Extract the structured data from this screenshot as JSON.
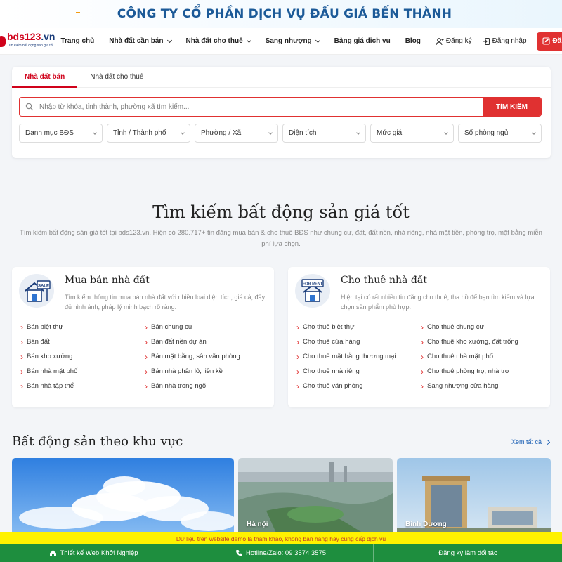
{
  "banner": {
    "title": "CÔNG TY CỔ PHẦN DỊCH VỤ ĐẤU GIÁ BẾN THÀNH"
  },
  "logo": {
    "main": "bds123",
    "tld": ".vn",
    "tagline": "Tìm kiếm bất động sản giá tốt"
  },
  "nav": {
    "items": [
      {
        "label": "Trang chủ",
        "dropdown": false
      },
      {
        "label": "Nhà đất cần bán",
        "dropdown": true
      },
      {
        "label": "Nhà đất cho thuê",
        "dropdown": true
      },
      {
        "label": "Sang nhượng",
        "dropdown": true
      },
      {
        "label": "Bảng giá dịch vụ",
        "dropdown": false
      },
      {
        "label": "Blog",
        "dropdown": false
      }
    ],
    "register": "Đăng ký",
    "login": "Đăng nhập",
    "post": "Đăng tin"
  },
  "search": {
    "tabs": [
      "Nhà đất bán",
      "Nhà đất cho thuê"
    ],
    "active_tab": 0,
    "placeholder": "Nhập từ khóa, tỉnh thành, phường xã tìm kiếm...",
    "button": "TÌM KIẾM",
    "filters": [
      "Danh mục BĐS",
      "Tỉnh / Thành phố",
      "Phường / Xã",
      "Diện tích",
      "Mức giá",
      "Số phòng ngủ"
    ]
  },
  "hero": {
    "title": "Tìm kiếm bất động sản giá tốt",
    "desc": "Tìm kiếm bất động sản giá tốt tại bds123.vn. Hiện có 280.717+ tin đăng mua bán & cho thuê BĐS như chung cư, đất, đất nền, nhà riêng, nhà mặt tiền, phòng trọ, mặt bằng miễn phí lựa chọn."
  },
  "cards": [
    {
      "title": "Mua bán nhà đất",
      "desc": "Tìm kiếm thông tin mua bán nhà đất với nhiều loại diện tích, giá cả, đầy đủ hình ảnh, pháp lý minh bạch rõ ràng.",
      "icon_text": "SALE",
      "links": [
        "Bán biệt thự",
        "Bán chung cư",
        "Bán đất",
        "Bán đất nền dự án",
        "Bán kho xưởng",
        "Bán mặt bằng, sân văn phòng",
        "Bán nhà mặt phố",
        "Bán nhà phân lô, liền kề",
        "Bán nhà tập thể",
        "Bán nhà trong ngõ"
      ]
    },
    {
      "title": "Cho thuê nhà đất",
      "desc": "Hiện tại có rất nhiều tin đăng cho thuê, tha hồ để bạn tìm kiếm và lựa chọn sản phẩm phù hợp.",
      "icon_text": "FOR RENT",
      "links": [
        "Cho thuê biệt thự",
        "Cho thuê chung cư",
        "Cho thuê cửa hàng",
        "Cho thuê kho xưởng, đất trống",
        "Cho thuê mặt bằng thương mại",
        "Cho thuê nhà mặt phố",
        "Cho thuê nhà riêng",
        "Cho thuê phòng trọ, nhà trọ",
        "Cho thuê văn phòng",
        "Sang nhượng cửa hàng"
      ]
    }
  ],
  "areas": {
    "title": "Bất động sản theo khu vực",
    "see_all": "Xem tất cả",
    "items": [
      {
        "label": ""
      },
      {
        "label": "Hà nội"
      },
      {
        "label": "Bình Dương"
      }
    ]
  },
  "notice": "Dữ liệu trên website demo là tham khảo, không bán hàng hay cung cấp dịch vụ",
  "footer": {
    "web": "Thiết kế Web Khởi Nghiệp",
    "hotline": "Hotline/Zalo: 09 3574 3575",
    "partner": "Đăng ký làm đối tác"
  },
  "colors": {
    "brand": "#d0021b",
    "accent": "#e03131",
    "navy": "#1c5a98",
    "footer": "#1e8e3e",
    "notice": "#fff200"
  }
}
